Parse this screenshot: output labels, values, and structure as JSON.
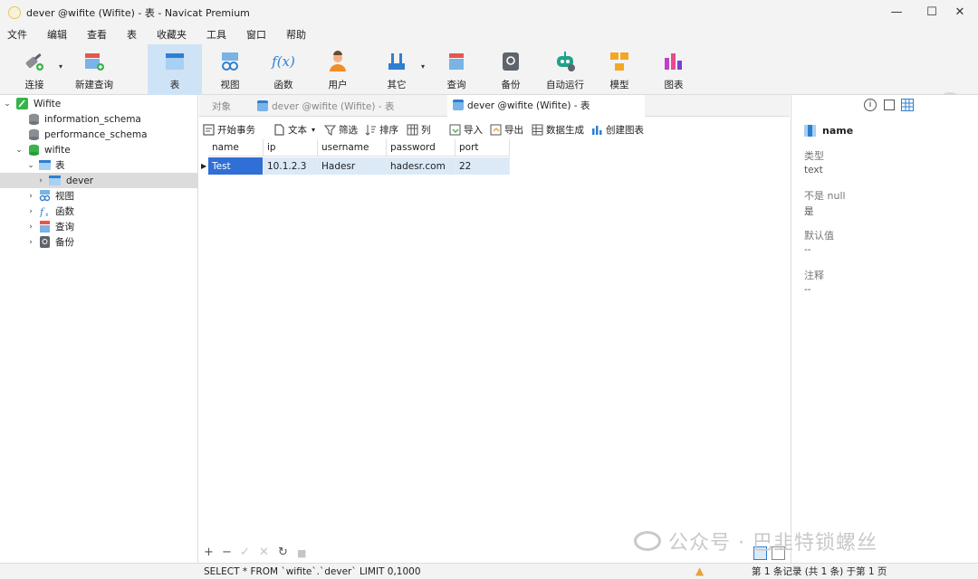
{
  "window": {
    "title": "dever @wifite (Wifite) - 表 - Navicat Premium",
    "controls": {
      "minimize": "—",
      "maximize": "☐",
      "close": "✕"
    }
  },
  "menu": [
    "文件",
    "编辑",
    "查看",
    "表",
    "收藏夹",
    "工具",
    "窗口",
    "帮助"
  ],
  "toolbar": {
    "connect": "连接",
    "new_query": "新建查询",
    "table": "表",
    "view": "视图",
    "function": "函数",
    "user": "用户",
    "other": "其它",
    "query": "查询",
    "backup": "备份",
    "automation": "自动运行",
    "model": "模型",
    "chart": "图表",
    "function_icon_text": "f(x)"
  },
  "tree": {
    "connection": "Wifite",
    "db1": "information_schema",
    "db2": "performance_schema",
    "db3": "wifite",
    "tables": "表",
    "table_dever": "dever",
    "views": "视图",
    "functions": "函数",
    "queries": "查询",
    "backups": "备份"
  },
  "tabs": {
    "objects": "对象",
    "tab1": "dever @wifite (Wifite) - 表",
    "tab2": "dever @wifite (Wifite) - 表"
  },
  "data_toolbar": {
    "begin_transaction": "开始事务",
    "text": "文本",
    "filter": "筛选",
    "sort": "排序",
    "columns": "列",
    "import": "导入",
    "export": "导出",
    "generate_data": "数据生成",
    "create_chart": "创建图表"
  },
  "grid": {
    "columns": [
      "name",
      "ip",
      "username",
      "password",
      "port"
    ],
    "rows": [
      [
        "Test",
        "10.1.2.3",
        "Hadesr",
        "hadesr.com",
        "22"
      ]
    ]
  },
  "bottom_controls": {
    "add": "+",
    "delete": "−",
    "apply": "✓",
    "discard": "✕",
    "refresh": "↻",
    "stop": "■"
  },
  "right_panel": {
    "field_name": "name",
    "type_label": "类型",
    "type_value": "text",
    "not_null_label": "不是 null",
    "not_null_value": "是",
    "default_label": "默认值",
    "default_value": "--",
    "comment_label": "注释",
    "comment_value": "--"
  },
  "status": {
    "sql": "SELECT * FROM `wifite`.`dever` LIMIT 0,1000",
    "record": "第 1 条记录 (共 1 条) 于第 1 页"
  },
  "watermark": "公众号 · 巴韭特锁螺丝",
  "colors": {
    "accent": "#2f6fd6",
    "selection_row": "#dce9f7",
    "active_tool": "#cfe3f7"
  }
}
